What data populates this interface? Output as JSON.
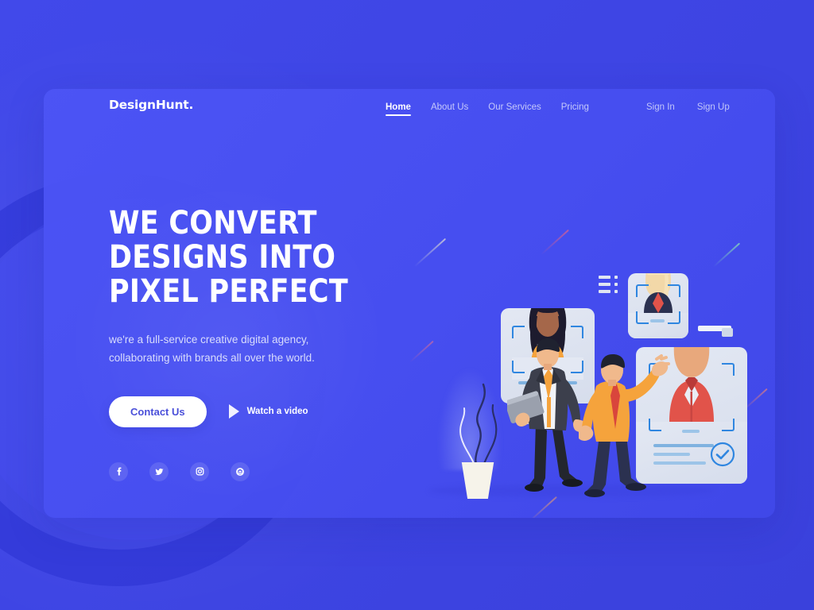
{
  "theme": {
    "page_bg": "#4048e8",
    "panel_bg": "#4c54f5",
    "accent_white": "#ffffff",
    "button_text": "#4a4fd9",
    "ring_dark": "#2a32d1",
    "card_bg": "#e3e8f3",
    "bracket_blue": "#2f86e0",
    "line_blue": "#9cc4e8",
    "orange": "#f5a33c",
    "red_shirt": "#e1534a",
    "suit_dark": "#3c3f4c",
    "navy": "#2b3150"
  },
  "header": {
    "logo": "DesignHunt.",
    "nav": [
      {
        "label": "Home",
        "active": true
      },
      {
        "label": "About Us",
        "active": false
      },
      {
        "label": "Our Services",
        "active": false
      },
      {
        "label": "Pricing",
        "active": false
      }
    ],
    "auth": [
      {
        "label": "Sign In"
      },
      {
        "label": "Sign Up"
      }
    ]
  },
  "hero": {
    "headline_lines": [
      "WE CONVERT",
      "DESIGNS INTO",
      "PIXEL PERFECT"
    ],
    "subtitle_lines": [
      "we're a full-service creative digital agency,",
      "collaborating with brands all over the world."
    ],
    "primary_button": "Contact Us",
    "video_link": "Watch a video",
    "play_icon": "play-triangle-icon",
    "socials": [
      {
        "name": "facebook-icon",
        "glyph": "f"
      },
      {
        "name": "twitter-icon",
        "glyph": "t"
      },
      {
        "name": "instagram-icon",
        "glyph": "camera"
      },
      {
        "name": "dribbble-icon",
        "glyph": "ball"
      }
    ]
  },
  "illustration": {
    "description": "Recruitment themed flat illustration: three profile ID cards with portrait photos framed by blue scanner brackets, two businessmen shaking hands in front of them, a potted plant at left, floating list icon and paper snippets.",
    "list_icon": "list-view-icon",
    "verified_badge": "check-circle-icon",
    "cards": [
      {
        "name": "profile-card-woman-orange",
        "portrait": "woman-dark-hair-orange-top"
      },
      {
        "name": "profile-card-woman-blonde",
        "portrait": "woman-blonde-navy-blazer-red-top"
      },
      {
        "name": "profile-card-man-red",
        "portrait": "man-ginger-hair-red-shirt",
        "verified": true
      }
    ],
    "figures": [
      {
        "name": "businessman-dark-suit",
        "detail": "dark suit, orange tie, holding gray folder, hand extended"
      },
      {
        "name": "businessman-orange-sweater",
        "detail": "orange sweater, navy trousers, red tie, raised hand"
      }
    ],
    "decor": {
      "plant": "potted-plant",
      "streaks": 6
    }
  }
}
